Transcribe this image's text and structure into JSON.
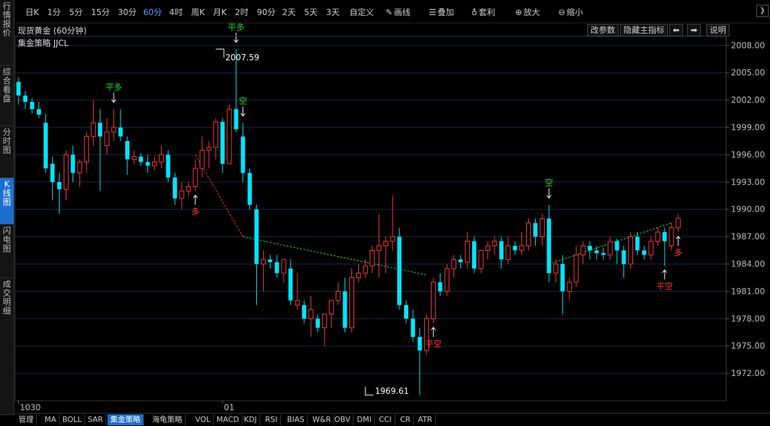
{
  "toolbar": {
    "periods": [
      "日K",
      "1分",
      "5分",
      "15分",
      "30分",
      "60分",
      "4时",
      "周K",
      "月K",
      "2时",
      "90分",
      "2天",
      "5天",
      "3天",
      "自定义"
    ],
    "active_period": "60分",
    "draw_label": "画线",
    "overlay_label": "叠加",
    "arbitrage_label": "套利",
    "zoom_in_label": "放大",
    "zoom_out_label": "缩小"
  },
  "sidebar": {
    "items": [
      "行情报价",
      "综合看盘",
      "分时图",
      "K线图",
      "闪电图",
      "成交明细"
    ],
    "active": "K线图"
  },
  "header": {
    "title": "现货黄金 (60分钟)",
    "buttons": [
      "改参数",
      "隐藏主指标",
      "⬅",
      "➡",
      "说明"
    ]
  },
  "strategy_label": "集金策略 JJCL",
  "bottom_tabs": {
    "items": [
      "管理",
      "MA",
      "BOLL",
      "SAR",
      "集金策略",
      "海龟策略",
      "VOL",
      "MACD",
      "KDJ",
      "RSI",
      "BIAS",
      "W&R",
      "OBV",
      "DMI",
      "CCI",
      "CR",
      "ATR"
    ],
    "active": "集金策略"
  },
  "colors": {
    "up": "#ff3b3b",
    "down": "#00e5ff",
    "signal_green": "#22dd22",
    "signal_red": "#ff3333",
    "trend_green": "#22dd22",
    "trend_red": "#ff3333",
    "grid": "#1a2a44",
    "axis_text": "#bbbbbb"
  },
  "chart_data": {
    "type": "candlestick",
    "ylim": [
      1969.0,
      2009.0
    ],
    "yticks": [
      "2008.00",
      "2005.00",
      "2002.00",
      "1999.00",
      "1996.00",
      "1993.00",
      "1990.00",
      "1987.00",
      "1984.00",
      "1981.00",
      "1978.00",
      "1975.00",
      "1972.00"
    ],
    "x_labels": [
      {
        "index": 0,
        "label": "1030"
      },
      {
        "index": 30,
        "label": "01"
      }
    ],
    "max_label": {
      "index": 29,
      "value": 2007.59,
      "text": "2007.59"
    },
    "min_label": {
      "index": 51,
      "value": 1969.61,
      "text": "1969.61"
    },
    "ohlc": [
      [
        2004.0,
        2004.5,
        2001.5,
        2002.5
      ],
      [
        2002.5,
        2003.0,
        2001.0,
        2001.8
      ],
      [
        2001.8,
        2002.2,
        2000.5,
        2001.0
      ],
      [
        2001.0,
        2001.8,
        2000.0,
        2000.4
      ],
      [
        1999.5,
        2000.5,
        1994.0,
        1994.5
      ],
      [
        1995.0,
        1995.8,
        1991.0,
        1993.0
      ],
      [
        1993.0,
        1994.0,
        1989.5,
        1992.2
      ],
      [
        1992.2,
        1996.5,
        1991.0,
        1996.0
      ],
      [
        1996.0,
        1997.0,
        1993.0,
        1994.0
      ],
      [
        1994.0,
        1995.5,
        1992.5,
        1995.2
      ],
      [
        1995.2,
        1998.5,
        1994.0,
        1998.0
      ],
      [
        1998.0,
        2002.0,
        1997.0,
        1999.5
      ],
      [
        1999.5,
        2001.0,
        1992.0,
        1998.0
      ],
      [
        1997.0,
        2000.0,
        1996.0,
        1998.5
      ],
      [
        1998.5,
        2001.0,
        1997.5,
        1999.0
      ],
      [
        1999.0,
        2001.0,
        1997.5,
        1998.0
      ],
      [
        1997.5,
        1998.0,
        1993.8,
        1995.5
      ],
      [
        1995.5,
        1996.5,
        1995.0,
        1995.8
      ],
      [
        1995.8,
        1996.2,
        1994.8,
        1995.2
      ],
      [
        1995.2,
        1996.0,
        1994.0,
        1994.8
      ],
      [
        1994.8,
        1995.8,
        1994.3,
        1995.2
      ],
      [
        1995.2,
        1997.0,
        1994.5,
        1996.0
      ],
      [
        1996.0,
        1996.5,
        1993.0,
        1993.5
      ],
      [
        1993.5,
        1994.0,
        1990.5,
        1991.2
      ],
      [
        1991.2,
        1993.0,
        1990.0,
        1992.0
      ],
      [
        1992.0,
        1993.0,
        1991.5,
        1992.5
      ],
      [
        1992.5,
        1995.5,
        1992.0,
        1994.5
      ],
      [
        1994.5,
        1998.0,
        1993.5,
        1996.5
      ],
      [
        1996.5,
        1997.5,
        1994.5,
        1996.8
      ],
      [
        1996.8,
        2000.0,
        1995.5,
        1999.6
      ],
      [
        1999.6,
        2000.0,
        1994.0,
        1995.0
      ],
      [
        1995.0,
        2001.5,
        1995.0,
        2001.0
      ],
      [
        2001.0,
        2007.59,
        1998.5,
        1998.8
      ],
      [
        1998.0,
        1999.5,
        1993.0,
        1994.0
      ],
      [
        1994.0,
        1994.5,
        1990.0,
        1990.5
      ],
      [
        1990.0,
        1990.5,
        1979.5,
        1984.0
      ],
      [
        1984.0,
        1985.5,
        1981.0,
        1984.5
      ],
      [
        1984.5,
        1985.0,
        1983.5,
        1984.2
      ],
      [
        1984.2,
        1985.0,
        1982.5,
        1983.0
      ],
      [
        1983.0,
        1984.5,
        1982.0,
        1984.5
      ],
      [
        1983.5,
        1984.5,
        1979.5,
        1980.0
      ],
      [
        1979.5,
        1983.0,
        1979.0,
        1980.0
      ],
      [
        1979.5,
        1980.0,
        1977.5,
        1978.0
      ],
      [
        1978.0,
        1980.5,
        1976.0,
        1979.0
      ],
      [
        1978.0,
        1978.5,
        1976.5,
        1977.0
      ],
      [
        1977.0,
        1978.0,
        1975.0,
        1978.5
      ],
      [
        1978.5,
        1980.0,
        1977.0,
        1980.0
      ],
      [
        1980.0,
        1982.0,
        1979.5,
        1981.0
      ],
      [
        1981.0,
        1982.5,
        1976.5,
        1977.0
      ],
      [
        1977.0,
        1983.5,
        1976.5,
        1982.5
      ],
      [
        1982.5,
        1984.0,
        1982.0,
        1983.0
      ],
      [
        1983.0,
        1984.5,
        1982.5,
        1983.8
      ],
      [
        1983.8,
        1986.0,
        1983.0,
        1985.5
      ],
      [
        1985.5,
        1989.5,
        1982.5,
        1986.0
      ],
      [
        1986.0,
        1987.0,
        1983.0,
        1986.5
      ],
      [
        1986.5,
        1991.5,
        1985.5,
        1987.0
      ],
      [
        1987.0,
        1988.0,
        1979.0,
        1979.5
      ],
      [
        1979.5,
        1980.0,
        1977.5,
        1978.0
      ],
      [
        1978.0,
        1979.0,
        1975.5,
        1976.0
      ],
      [
        1976.0,
        1977.0,
        1969.61,
        1974.5
      ],
      [
        1974.5,
        1978.5,
        1974.0,
        1978.0
      ],
      [
        1978.0,
        1982.5,
        1977.5,
        1982.0
      ],
      [
        1982.0,
        1983.0,
        1980.5,
        1981.0
      ],
      [
        1981.0,
        1984.0,
        1980.5,
        1983.5
      ],
      [
        1983.5,
        1985.0,
        1982.5,
        1984.5
      ],
      [
        1984.5,
        1985.0,
        1983.5,
        1984.2
      ],
      [
        1984.2,
        1987.5,
        1983.5,
        1986.5
      ],
      [
        1986.5,
        1987.0,
        1983.0,
        1983.5
      ],
      [
        1983.5,
        1985.5,
        1983.0,
        1985.5
      ],
      [
        1985.5,
        1986.5,
        1984.5,
        1986.0
      ],
      [
        1986.0,
        1987.0,
        1985.0,
        1986.5
      ],
      [
        1986.5,
        1987.0,
        1983.5,
        1984.5
      ],
      [
        1984.5,
        1987.0,
        1984.0,
        1986.0
      ],
      [
        1986.0,
        1986.5,
        1985.0,
        1985.5
      ],
      [
        1985.5,
        1987.5,
        1985.0,
        1986.0
      ],
      [
        1986.0,
        1989.0,
        1985.5,
        1988.5
      ],
      [
        1988.5,
        1989.0,
        1986.0,
        1987.0
      ],
      [
        1987.0,
        1989.5,
        1986.0,
        1989.0
      ],
      [
        1989.0,
        1990.5,
        1982.0,
        1983.0
      ],
      [
        1983.0,
        1984.5,
        1982.0,
        1984.0
      ],
      [
        1984.0,
        1985.0,
        1978.5,
        1981.0
      ],
      [
        1981.0,
        1982.5,
        1980.0,
        1982.0
      ],
      [
        1982.0,
        1986.0,
        1981.5,
        1985.0
      ],
      [
        1985.0,
        1986.5,
        1984.0,
        1986.0
      ],
      [
        1986.0,
        1986.5,
        1984.5,
        1985.5
      ],
      [
        1985.5,
        1986.0,
        1984.5,
        1985.2
      ],
      [
        1985.2,
        1985.8,
        1984.5,
        1985.0
      ],
      [
        1985.0,
        1987.0,
        1984.5,
        1986.5
      ],
      [
        1986.5,
        1986.8,
        1984.0,
        1985.5
      ],
      [
        1985.5,
        1986.0,
        1982.5,
        1984.0
      ],
      [
        1984.0,
        1987.5,
        1983.5,
        1987.0
      ],
      [
        1987.0,
        1987.5,
        1985.0,
        1985.5
      ],
      [
        1985.5,
        1986.0,
        1984.5,
        1985.0
      ],
      [
        1985.0,
        1987.0,
        1984.5,
        1986.5
      ],
      [
        1986.5,
        1988.0,
        1986.0,
        1987.5
      ],
      [
        1987.5,
        1988.0,
        1983.8,
        1986.5
      ],
      [
        1986.0,
        1988.5,
        1985.5,
        1988.0
      ],
      [
        1988.0,
        1989.5,
        1987.5,
        1989.0
      ]
    ],
    "signals": [
      {
        "index": 14,
        "text": "平多",
        "position": "above",
        "color": "green"
      },
      {
        "index": 26,
        "text": "多",
        "position": "below",
        "color": "red"
      },
      {
        "index": 32,
        "text": "平多",
        "position": "above",
        "color": "green"
      },
      {
        "index": 33,
        "text": "空",
        "position": "above",
        "color": "green"
      },
      {
        "index": 61,
        "text": "平空",
        "position": "below",
        "color": "red"
      },
      {
        "index": 78,
        "text": "空",
        "position": "above",
        "color": "green"
      },
      {
        "index": 95,
        "text": "平空",
        "position": "below",
        "color": "red"
      },
      {
        "index": 97,
        "text": "多",
        "position": "below",
        "color": "red"
      }
    ],
    "trend_lines": [
      {
        "color": "red",
        "points": [
          [
            26,
            1996.0
          ],
          [
            33,
            1987.0
          ]
        ]
      },
      {
        "color": "green",
        "points": [
          [
            33,
            1987.0
          ],
          [
            60,
            1982.8
          ]
        ]
      },
      {
        "color": "green",
        "points": [
          [
            78,
            1984.0
          ],
          [
            96,
            1988.5
          ]
        ]
      }
    ]
  }
}
